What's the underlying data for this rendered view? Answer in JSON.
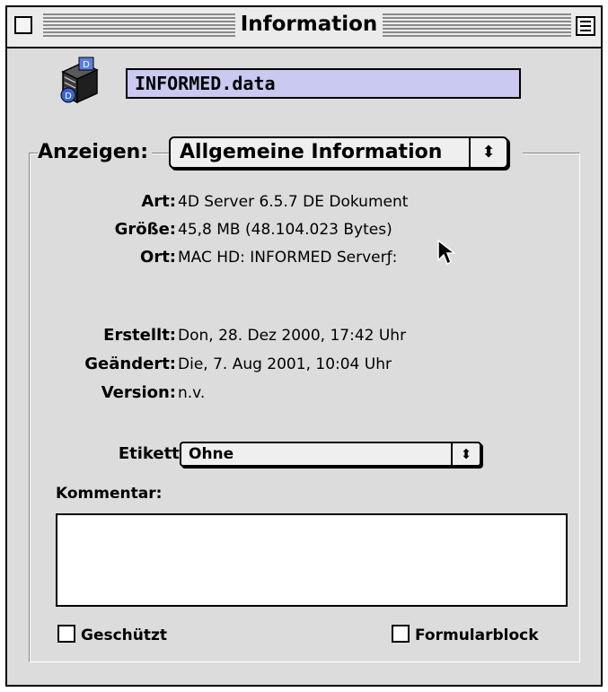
{
  "window": {
    "title": "Information"
  },
  "file": {
    "icon": "4d-database-file-icon",
    "name": "INFORMED.data"
  },
  "show": {
    "label": "Anzeigen:",
    "selected": "Allgemeine Information"
  },
  "info": [
    {
      "label": "Art:",
      "value": "4D Server 6.5.7 DE Dokument"
    },
    {
      "label": "Größe:",
      "value": "45,8 MB (48.104.023 Bytes)"
    },
    {
      "label": "Ort:",
      "value": "MAC HD: INFORMED Serverƒ:"
    },
    {
      "label": "Erstellt:",
      "value": "Don, 28. Dez 2000, 17:42 Uhr"
    },
    {
      "label": "Geändert:",
      "value": "Die, 7. Aug 2001, 10:04 Uhr"
    },
    {
      "label": "Version:",
      "value": "n.v."
    }
  ],
  "label_select": {
    "label": "Etikett:",
    "selected": "Ohne"
  },
  "comment": {
    "label": "Kommentar:",
    "value": ""
  },
  "checkboxes": {
    "locked": {
      "label": "Geschützt",
      "checked": false
    },
    "stationery": {
      "label": "Formularblock",
      "checked": false
    }
  },
  "colors": {
    "filename_highlight": "#c9c9f2",
    "window_bg": "#dcdcdc"
  }
}
